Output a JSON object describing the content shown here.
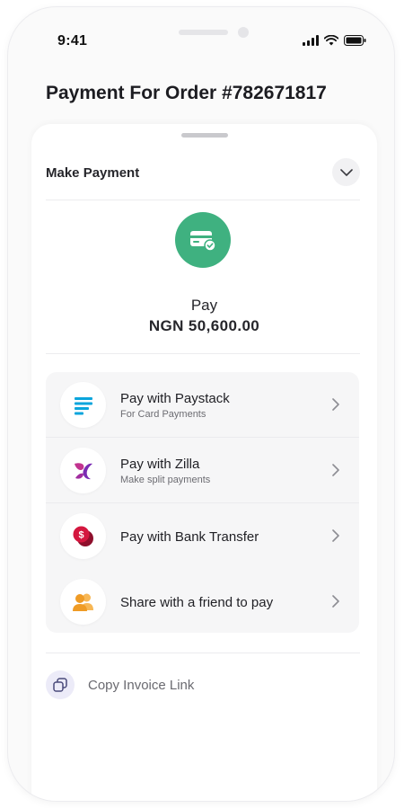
{
  "status_bar": {
    "time": "9:41"
  },
  "header": {
    "title": "Payment For  Order #782671817"
  },
  "sheet": {
    "section_label": "Make Payment",
    "pay_label": "Pay",
    "pay_amount": "NGN 50,600.00"
  },
  "payment_options": [
    {
      "title": "Pay with Paystack",
      "subtitle": "For Card Payments",
      "icon": "paystack-icon",
      "icon_color": "#0aa5dc"
    },
    {
      "title": "Pay with Zilla",
      "subtitle": "Make split payments",
      "icon": "zilla-icon",
      "icon_color": "#8a2bb8"
    },
    {
      "title": "Pay with Bank Transfer",
      "subtitle": "",
      "icon": "bank-transfer-icon",
      "icon_color": "#c4133c"
    },
    {
      "title": "Share with a friend to pay",
      "subtitle": "",
      "icon": "friends-icon",
      "icon_color": "#f2a53a"
    }
  ],
  "copy_invoice": {
    "label": "Copy Invoice Link"
  },
  "colors": {
    "accent_green": "#3fb180",
    "copy_icon_bg": "#ecebf8"
  }
}
